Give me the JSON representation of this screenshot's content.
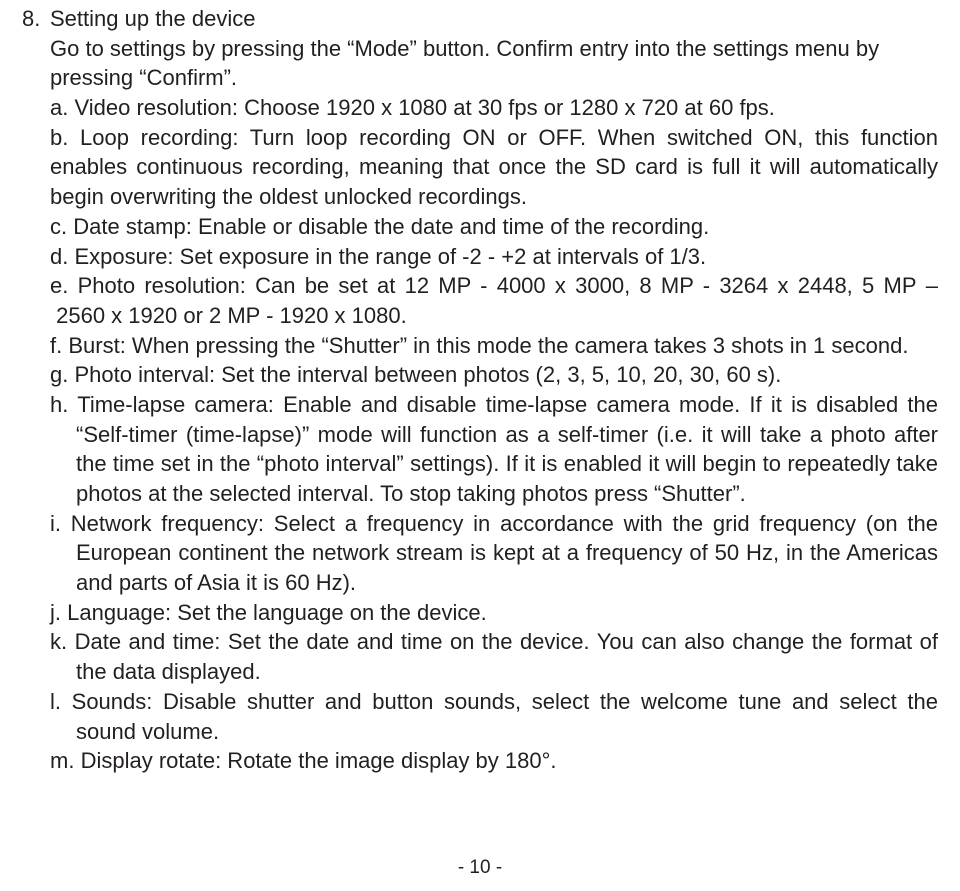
{
  "section": {
    "number": "8.",
    "title": "Setting up the device",
    "intro": "Go to settings by pressing the “Mode” button. Confirm entry into the settings menu by pressing “Confirm”.",
    "items": [
      {
        "marker": "a.",
        "text": "Video resolution: Choose 1920 x 1080 at 30 fps or 1280 x 720 at 60 fps."
      },
      {
        "marker": "b.",
        "text": "Loop recording: Turn loop recording ON or OFF. When switched ON, this function enables continuous recording, meaning that once the SD card is full it will automatically begin overwriting the oldest unlocked recordings."
      },
      {
        "marker": "c.",
        "text": "Date stamp: Enable or disable the date and time of the recording."
      },
      {
        "marker": "d.",
        "text": "Exposure: Set exposure in the range of -2 - +2 at intervals of 1/3."
      },
      {
        "marker": "e.",
        "text": "Photo resolution: Can be set at 12 MP - 4000 x 3000, 8 MP - 3264 x 2448, 5 MP – 2560 x 1920 or 2 MP - 1920 x 1080."
      },
      {
        "marker": "f.",
        "text": "Burst: When pressing the “Shutter” in this mode the camera takes 3 shots in 1 second."
      },
      {
        "marker": "g.",
        "text": "Photo interval: Set the interval between photos (2, 3, 5, 10, 20, 30, 60 s)."
      },
      {
        "marker": "h.",
        "text": "Time-lapse camera: Enable and disable time-lapse camera mode. If it is disabled the “Self-timer (time-lapse)” mode will function as a self-timer (i.e. it will take a photo after the time set in the “photo interval” settings). If it is enabled it will begin to repeatedly take photos at the selected interval. To stop taking photos press “Shutter”."
      },
      {
        "marker": "i.",
        "text": "Network frequency: Select a frequency in accordance with the grid frequency (on the European continent the network stream is kept at a frequency of 50 Hz, in the Americas and parts of Asia it is 60 Hz)."
      },
      {
        "marker": "j.",
        "text": "Language: Set the language on the device."
      },
      {
        "marker": "k.",
        "text": "Date and time: Set the date and time on the device. You can also change the format of the data displayed."
      },
      {
        "marker": "l.",
        "text": "Sounds: Disable shutter and button sounds, select the welcome tune and select the sound volume."
      },
      {
        "marker": "m.",
        "text": "Display rotate: Rotate the image display by 180°."
      }
    ]
  },
  "page_number": "- 10 -"
}
